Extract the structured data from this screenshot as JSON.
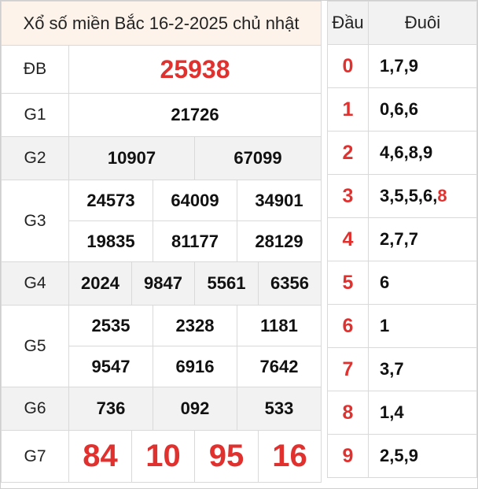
{
  "title": "Xổ số miền Bắc 16-2-2025 chủ nhật",
  "prizes": {
    "db": {
      "label": "ĐB",
      "numbers": [
        "25938"
      ]
    },
    "g1": {
      "label": "G1",
      "numbers": [
        "21726"
      ]
    },
    "g2": {
      "label": "G2",
      "numbers": [
        "10907",
        "67099"
      ]
    },
    "g3": {
      "label": "G3",
      "numbers": [
        "24573",
        "64009",
        "34901",
        "19835",
        "81177",
        "28129"
      ]
    },
    "g4": {
      "label": "G4",
      "numbers": [
        "2024",
        "9847",
        "5561",
        "6356"
      ]
    },
    "g5": {
      "label": "G5",
      "numbers": [
        "2535",
        "2328",
        "1181",
        "9547",
        "6916",
        "7642"
      ]
    },
    "g6": {
      "label": "G6",
      "numbers": [
        "736",
        "092",
        "533"
      ]
    },
    "g7": {
      "label": "G7",
      "numbers": [
        "84",
        "10",
        "95",
        "16"
      ]
    }
  },
  "loto": {
    "head_label": "Đầu",
    "tail_label": "Đuôi",
    "rows": [
      {
        "head": "0",
        "tails": "1,7,9"
      },
      {
        "head": "1",
        "tails": "0,6,6"
      },
      {
        "head": "2",
        "tails": "4,6,8,9"
      },
      {
        "head": "3",
        "tails": "3,5,5,6,",
        "tails_highlight": "8"
      },
      {
        "head": "4",
        "tails": "2,7,7"
      },
      {
        "head": "5",
        "tails": "6"
      },
      {
        "head": "6",
        "tails": "1"
      },
      {
        "head": "7",
        "tails": "3,7"
      },
      {
        "head": "8",
        "tails": "1,4"
      },
      {
        "head": "9",
        "tails": "2,5,9"
      }
    ]
  },
  "colors": {
    "accent_red": "#e0312f",
    "title_bg": "#fdf3ea",
    "row_gray": "#f2f2f2"
  }
}
